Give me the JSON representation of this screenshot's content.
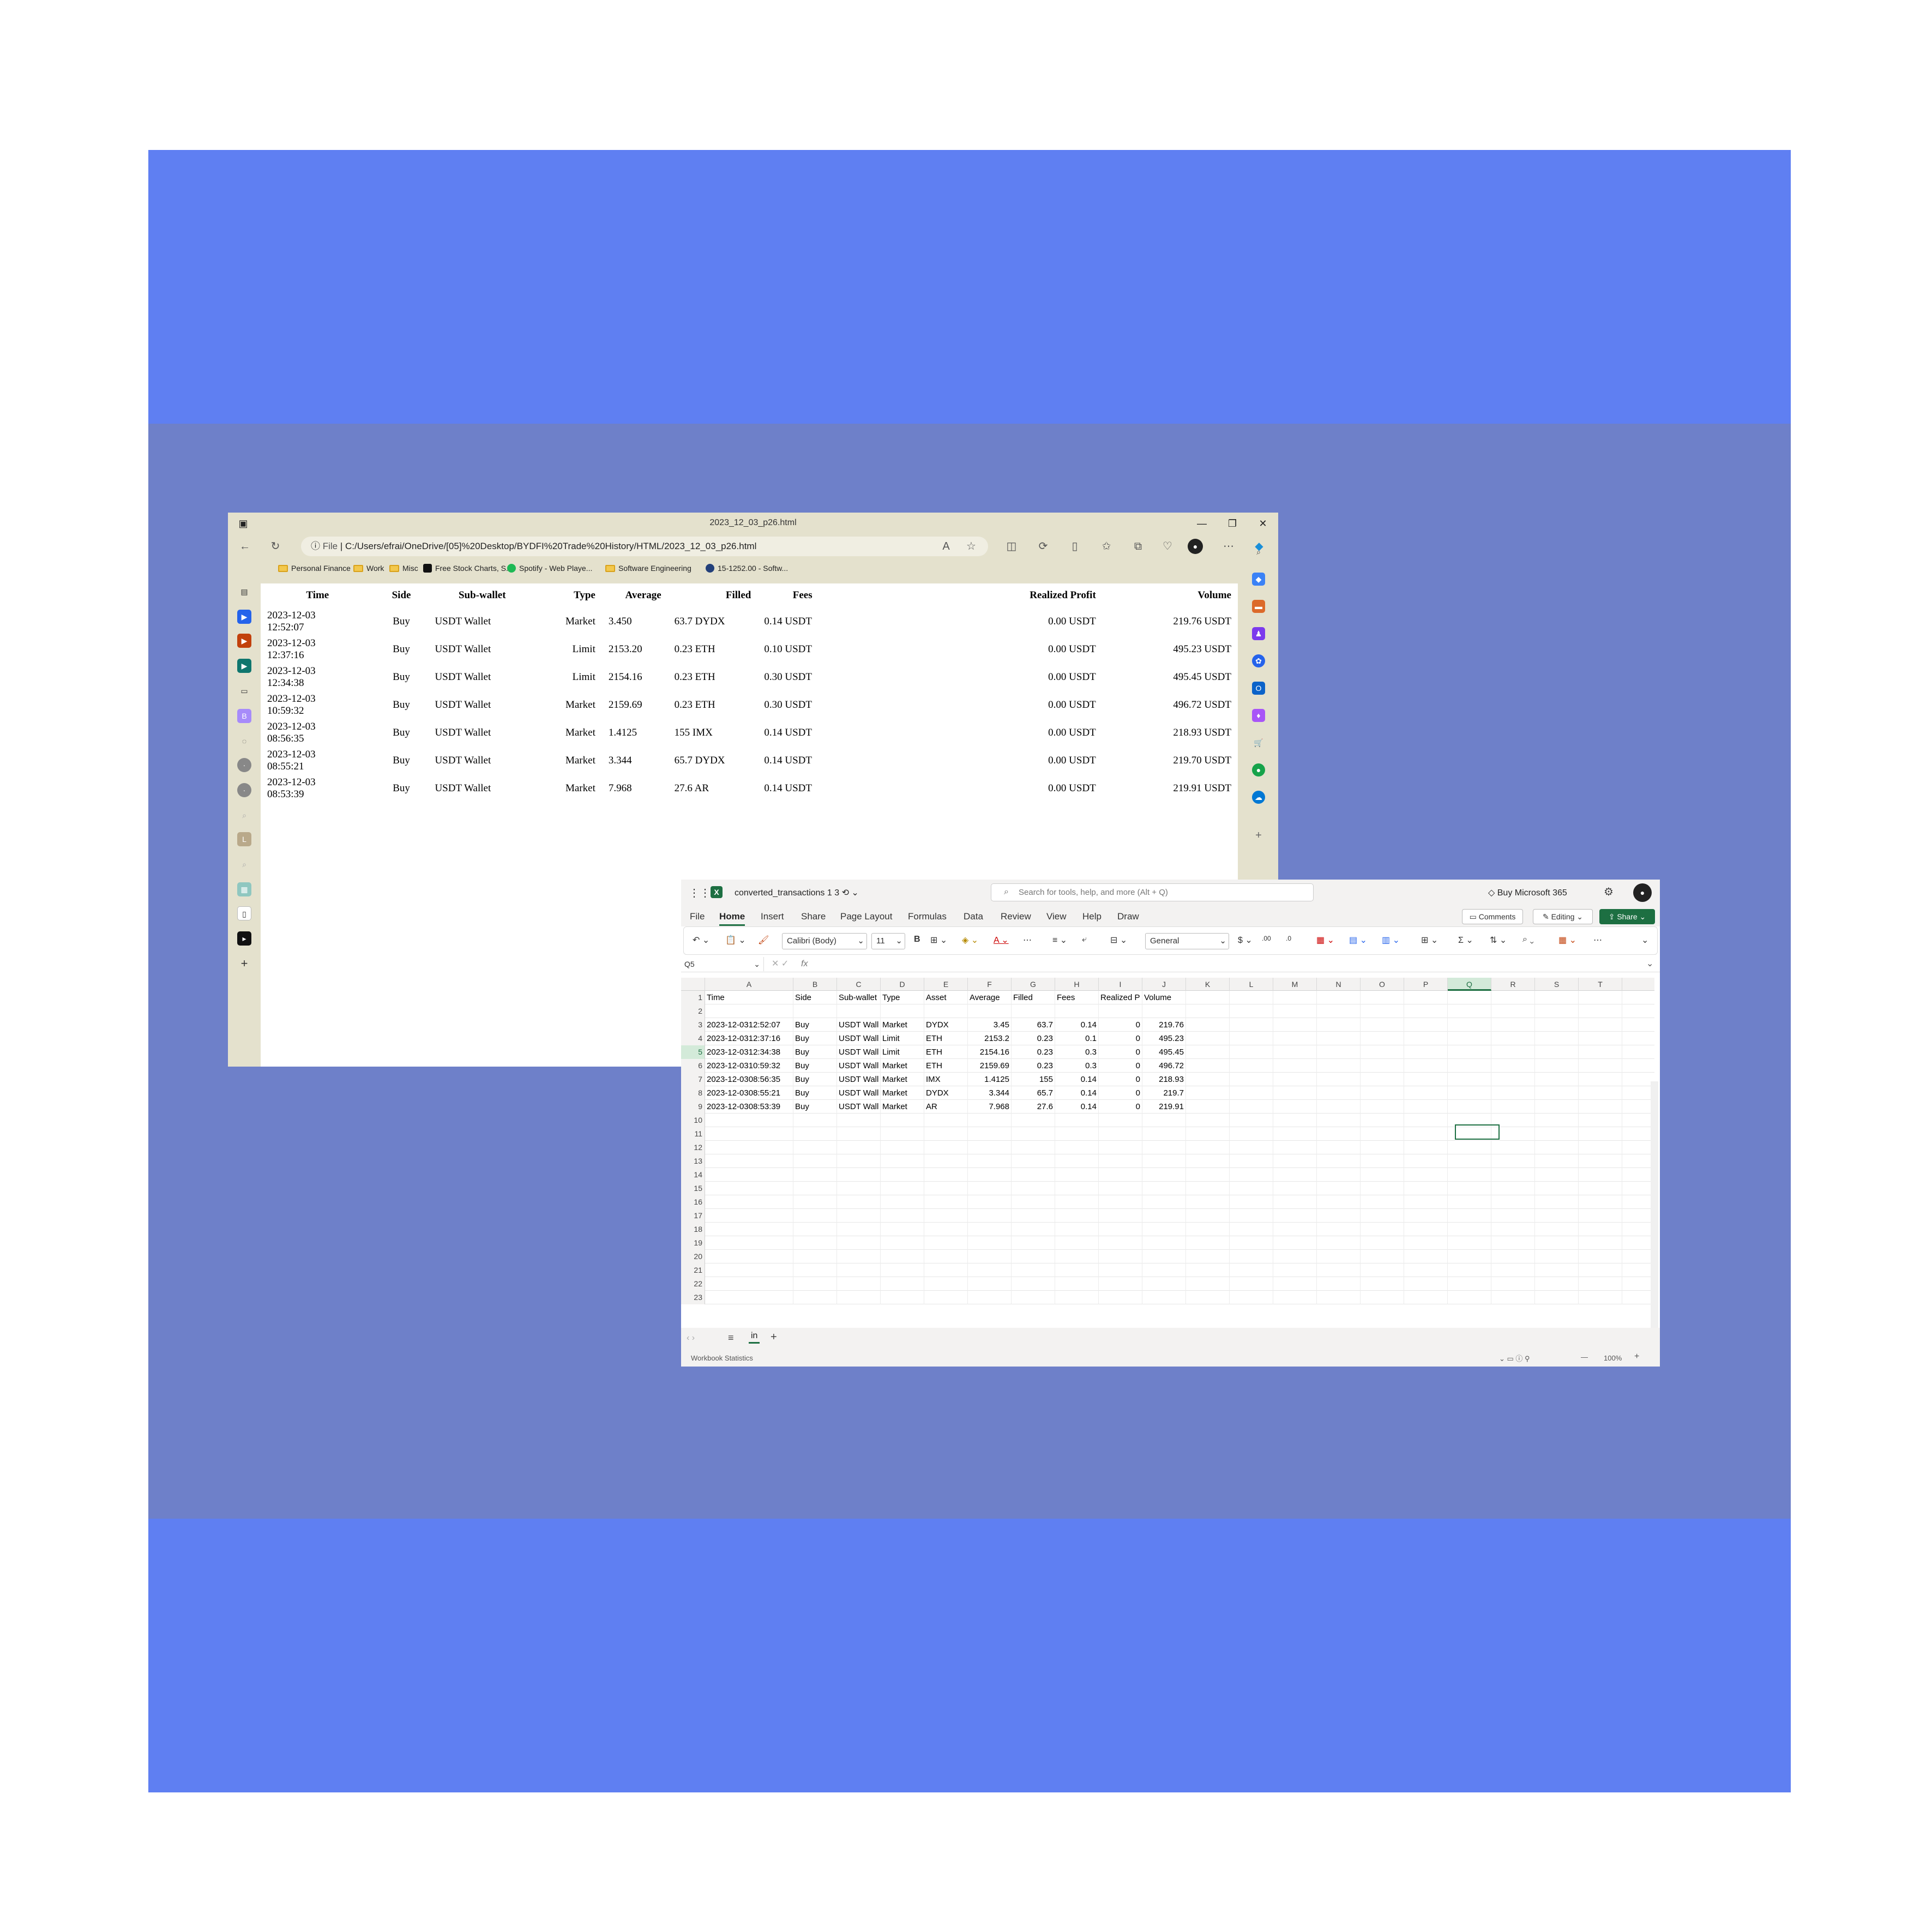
{
  "browser": {
    "tab_title": "2023_12_03_p26.html",
    "address": {
      "prefix": "File",
      "url": "C:/Users/efrai/OneDrive/[05]%20Desktop/BYDFI%20Trade%20History/HTML/2023_12_03_p26.html"
    },
    "favorites": [
      {
        "label": "Personal Finance",
        "icon": "folder-icon"
      },
      {
        "label": "Work",
        "icon": "folder-icon"
      },
      {
        "label": "Misc",
        "icon": "folder-icon"
      },
      {
        "label": "Free Stock Charts, S...",
        "icon": "tradingview-icon"
      },
      {
        "label": "Spotify - Web Playe...",
        "icon": "spotify-icon"
      },
      {
        "label": "Software Engineering",
        "icon": "folder-icon"
      },
      {
        "label": "15-1252.00 - Softw...",
        "icon": "onet-icon"
      }
    ],
    "table": {
      "headers": [
        "Time",
        "Side",
        "Sub-wallet",
        "Type",
        "Average",
        "Filled",
        "Fees",
        "Realized Profit",
        "Volume"
      ],
      "rows": [
        {
          "date": "2023-12-03",
          "time": "12:52:07",
          "side": "Buy",
          "wallet": "USDT Wallet",
          "type": "Market",
          "average": "3.450",
          "filled": "63.7 DYDX",
          "fees": "0.14 USDT",
          "profit": "0.00 USDT",
          "volume": "219.76 USDT"
        },
        {
          "date": "2023-12-03",
          "time": "12:37:16",
          "side": "Buy",
          "wallet": "USDT Wallet",
          "type": "Limit",
          "average": "2153.20",
          "filled": "0.23 ETH",
          "fees": "0.10 USDT",
          "profit": "0.00 USDT",
          "volume": "495.23 USDT"
        },
        {
          "date": "2023-12-03",
          "time": "12:34:38",
          "side": "Buy",
          "wallet": "USDT Wallet",
          "type": "Limit",
          "average": "2154.16",
          "filled": "0.23 ETH",
          "fees": "0.30 USDT",
          "profit": "0.00 USDT",
          "volume": "495.45 USDT"
        },
        {
          "date": "2023-12-03",
          "time": "10:59:32",
          "side": "Buy",
          "wallet": "USDT Wallet",
          "type": "Market",
          "average": "2159.69",
          "filled": "0.23 ETH",
          "fees": "0.30 USDT",
          "profit": "0.00 USDT",
          "volume": "496.72 USDT"
        },
        {
          "date": "2023-12-03",
          "time": "08:56:35",
          "side": "Buy",
          "wallet": "USDT Wallet",
          "type": "Market",
          "average": "1.4125",
          "filled": "155 IMX",
          "fees": "0.14 USDT",
          "profit": "0.00 USDT",
          "volume": "218.93 USDT"
        },
        {
          "date": "2023-12-03",
          "time": "08:55:21",
          "side": "Buy",
          "wallet": "USDT Wallet",
          "type": "Market",
          "average": "3.344",
          "filled": "65.7 DYDX",
          "fees": "0.14 USDT",
          "profit": "0.00 USDT",
          "volume": "219.70 USDT"
        },
        {
          "date": "2023-12-03",
          "time": "08:53:39",
          "side": "Buy",
          "wallet": "USDT Wallet",
          "type": "Market",
          "average": "7.968",
          "filled": "27.6 AR",
          "fees": "0.14 USDT",
          "profit": "0.00 USDT",
          "volume": "219.91 USDT"
        }
      ]
    }
  },
  "excel": {
    "doc_name": "converted_transactions 1 3",
    "search_placeholder": "Search for tools, help, and more (Alt + Q)",
    "buy_label": "Buy Microsoft 365",
    "menu": [
      "File",
      "Home",
      "Insert",
      "Share",
      "Page Layout",
      "Formulas",
      "Data",
      "Review",
      "View",
      "Help",
      "Draw"
    ],
    "active_menu": "Home",
    "comments_label": "Comments",
    "editing_label": "Editing",
    "share_label": "Share",
    "font_name": "Calibri (Body)",
    "font_size": "11",
    "number_format": "General",
    "name_box": "Q5",
    "fx_label": "fx",
    "columns": [
      "A",
      "B",
      "C",
      "D",
      "E",
      "F",
      "G",
      "H",
      "I",
      "J",
      "K",
      "L",
      "M",
      "N",
      "O",
      "P",
      "Q",
      "R",
      "S",
      "T"
    ],
    "selected_column": "Q",
    "selected_row": 5,
    "header_row": [
      "Time",
      "Side",
      "Sub-wallet",
      "Type",
      "Asset",
      "Average",
      "Filled",
      "Fees",
      "Realized P",
      "Volume"
    ],
    "data_rows": [
      [
        "2023-12-0312:52:07",
        "Buy",
        "USDT Wall",
        "Market",
        "DYDX",
        "3.45",
        "63.7",
        "0.14",
        "0",
        "219.76"
      ],
      [
        "2023-12-0312:37:16",
        "Buy",
        "USDT Wall",
        "Limit",
        "ETH",
        "2153.2",
        "0.23",
        "0.1",
        "0",
        "495.23"
      ],
      [
        "2023-12-0312:34:38",
        "Buy",
        "USDT Wall",
        "Limit",
        "ETH",
        "2154.16",
        "0.23",
        "0.3",
        "0",
        "495.45"
      ],
      [
        "2023-12-0310:59:32",
        "Buy",
        "USDT Wall",
        "Market",
        "ETH",
        "2159.69",
        "0.23",
        "0.3",
        "0",
        "496.72"
      ],
      [
        "2023-12-0308:56:35",
        "Buy",
        "USDT Wall",
        "Market",
        "IMX",
        "1.4125",
        "155",
        "0.14",
        "0",
        "218.93"
      ],
      [
        "2023-12-0308:55:21",
        "Buy",
        "USDT Wall",
        "Market",
        "DYDX",
        "3.344",
        "65.7",
        "0.14",
        "0",
        "219.7"
      ],
      [
        "2023-12-0308:53:39",
        "Buy",
        "USDT Wall",
        "Market",
        "AR",
        "7.968",
        "27.6",
        "0.14",
        "0",
        "219.91"
      ]
    ],
    "row_count": 23,
    "sheet_tab": "in",
    "status_left": "Workbook Statistics",
    "zoom": "100%"
  }
}
